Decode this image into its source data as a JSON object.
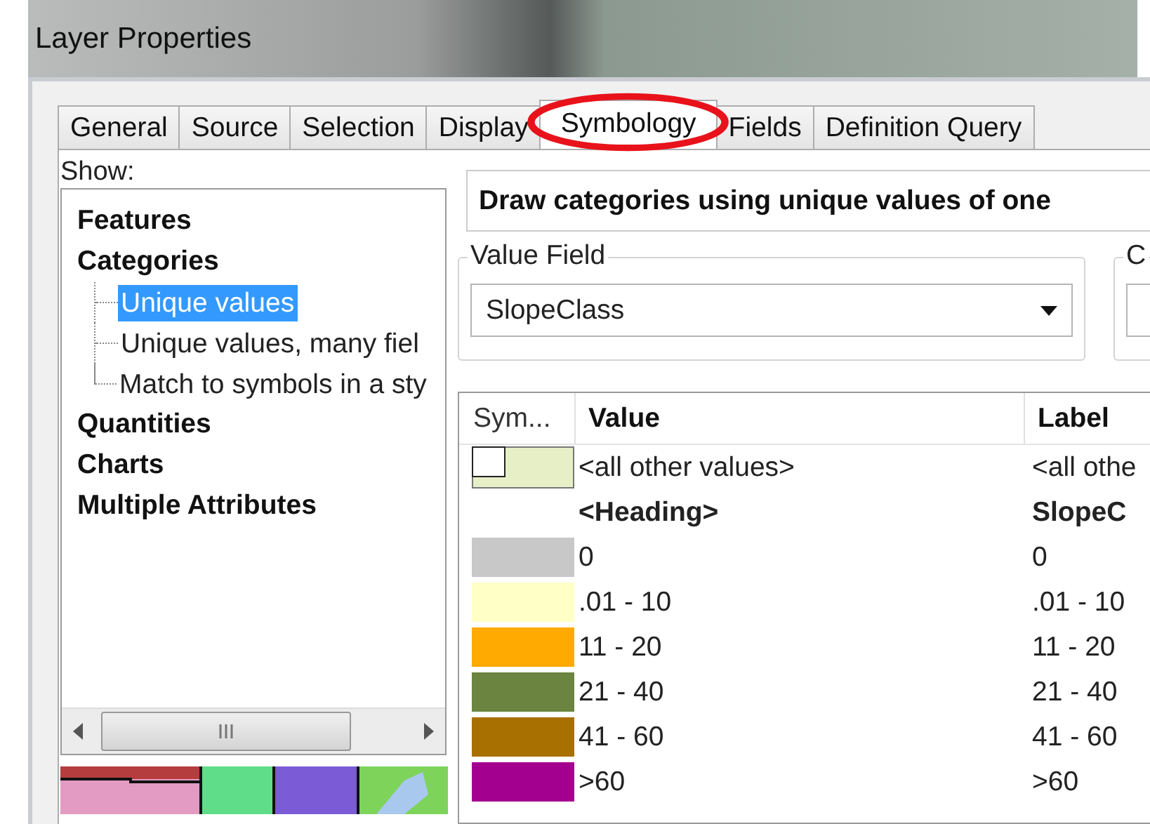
{
  "window": {
    "title": "Layer Properties"
  },
  "tabs": [
    {
      "label": "General",
      "selected": false,
      "circled": false
    },
    {
      "label": "Source",
      "selected": false,
      "circled": false
    },
    {
      "label": "Selection",
      "selected": false,
      "circled": false
    },
    {
      "label": "Display",
      "selected": false,
      "circled": false
    },
    {
      "label": "Symbology",
      "selected": true,
      "circled": true
    },
    {
      "label": "Fields",
      "selected": false,
      "circled": false
    },
    {
      "label": "Definition Query",
      "selected": false,
      "circled": false
    }
  ],
  "show": {
    "label": "Show:",
    "tree": [
      {
        "label": "Features",
        "selected": false
      },
      {
        "label": "Categories",
        "selected": false,
        "children": [
          {
            "label": "Unique values",
            "selected": true
          },
          {
            "label": "Unique values, many fiel",
            "selected": false
          },
          {
            "label": "Match to symbols in a sty",
            "selected": false
          }
        ]
      },
      {
        "label": "Quantities",
        "selected": false
      },
      {
        "label": "Charts",
        "selected": false
      },
      {
        "label": "Multiple Attributes",
        "selected": false
      }
    ]
  },
  "description": "Draw categories using unique values of one",
  "value_field": {
    "legend": "Value Field",
    "value": "SlopeClass"
  },
  "group_2": {
    "legend": "C"
  },
  "table": {
    "columns": [
      "Sym...",
      "Value",
      "Label"
    ],
    "rows": [
      {
        "kind": "other",
        "color": "#e6efc6",
        "value": "<all other values>",
        "label": "<all othe"
      },
      {
        "kind": "heading",
        "value": "<Heading>",
        "label": "SlopeC"
      },
      {
        "kind": "class",
        "color": "#c8c8c8",
        "value": "0",
        "label": "0"
      },
      {
        "kind": "class",
        "color": "#ffffc6",
        "value": ".01 - 10",
        "label": ".01 - 10"
      },
      {
        "kind": "class",
        "color": "#ffaa00",
        "value": "11 - 20",
        "label": "11 - 20"
      },
      {
        "kind": "class",
        "color": "#6b8440",
        "value": "21 - 40",
        "label": "21 - 40"
      },
      {
        "kind": "class",
        "color": "#a87000",
        "value": "41 - 60",
        "label": "41 - 60"
      },
      {
        "kind": "class",
        "color": "#a3008f",
        "value": ">60",
        "label": ">60"
      }
    ]
  }
}
